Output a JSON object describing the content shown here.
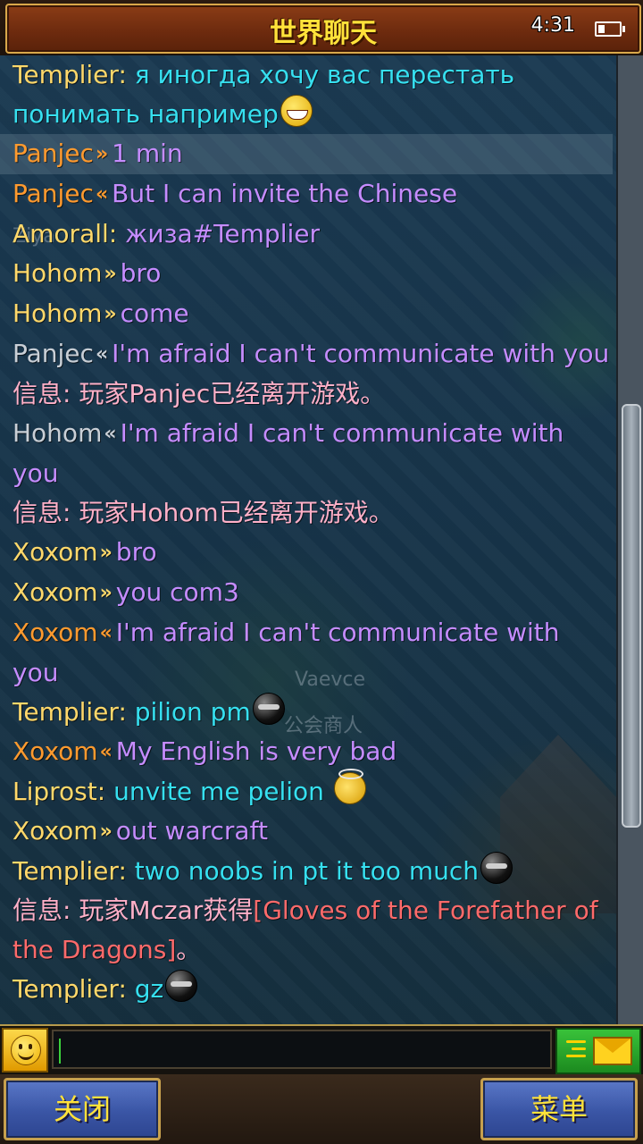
{
  "header": {
    "title": "世界聊天",
    "time": "4:31"
  },
  "colors": {
    "name_orange": "#ff9a2e",
    "name_yellow": "#ffd86a",
    "name_white": "#c9cfd6",
    "name_pink": "#ffb0c8",
    "world_text": "#36e0f0",
    "whisper_text": "#c58cff",
    "system_text": "#ffb0c8",
    "item_link": "#ff6a6a"
  },
  "background_labels": {
    "npc_name": "Vaevce",
    "shop_label": "公会商人",
    "left_name": "Ziya"
  },
  "messages": [
    {
      "sender": "Templier",
      "sep": ": ",
      "arrow": "",
      "text": "я иногда хочу вас перестать понимать например",
      "emoji": "grin",
      "name_color": "#ffd86a",
      "text_color": "#36e0f0",
      "highlight": false
    },
    {
      "sender": "Panjec",
      "sep": "",
      "arrow": "»",
      "text": "1 min",
      "emoji": "",
      "name_color": "#ff9a2e",
      "text_color": "#c58cff",
      "highlight": true
    },
    {
      "sender": "Panjec",
      "sep": "",
      "arrow": "«",
      "text": "But I can invite the Chinese",
      "emoji": "",
      "name_color": "#ff9a2e",
      "text_color": "#c58cff",
      "highlight": false
    },
    {
      "sender": "Amorall",
      "sep": ": ",
      "arrow": "",
      "text": "жиза#Templier",
      "emoji": "",
      "name_color": "#ffd86a",
      "text_color": "#c58cff",
      "highlight": false
    },
    {
      "sender": "Hohom",
      "sep": "",
      "arrow": "»",
      "text": "bro",
      "emoji": "",
      "name_color": "#ffd86a",
      "text_color": "#c58cff",
      "highlight": false
    },
    {
      "sender": "Hohom",
      "sep": "",
      "arrow": "»",
      "text": "come",
      "emoji": "",
      "name_color": "#ffd86a",
      "text_color": "#c58cff",
      "highlight": false
    },
    {
      "sender": "Panjec",
      "sep": "",
      "arrow": "«",
      "text": "I'm afraid I can't communicate with you",
      "emoji": "",
      "name_color": "#c9cfd6",
      "text_color": "#c58cff",
      "highlight": false
    },
    {
      "sender": "信息",
      "sep": ": ",
      "arrow": "",
      "text": "玩家Panjec已经离开游戏。",
      "emoji": "",
      "name_color": "#ffb0c8",
      "text_color": "#ffb0c8",
      "highlight": false
    },
    {
      "sender": "Hohom",
      "sep": "",
      "arrow": "«",
      "text": "I'm afraid I can't communicate with you",
      "emoji": "",
      "name_color": "#c9cfd6",
      "text_color": "#c58cff",
      "highlight": false
    },
    {
      "sender": "信息",
      "sep": ": ",
      "arrow": "",
      "text": "玩家Hohom已经离开游戏。",
      "emoji": "",
      "name_color": "#ffb0c8",
      "text_color": "#ffb0c8",
      "highlight": false
    },
    {
      "sender": "Xoxom",
      "sep": "",
      "arrow": "»",
      "text": "bro",
      "emoji": "",
      "name_color": "#ffd86a",
      "text_color": "#c58cff",
      "highlight": false
    },
    {
      "sender": "Xoxom",
      "sep": "",
      "arrow": "»",
      "text": "you com3",
      "emoji": "",
      "name_color": "#ffd86a",
      "text_color": "#c58cff",
      "highlight": false
    },
    {
      "sender": "Xoxom",
      "sep": "",
      "arrow": "«",
      "text": "I'm afraid I can't communicate with you",
      "emoji": "",
      "name_color": "#ff9a2e",
      "text_color": "#c58cff",
      "highlight": false
    },
    {
      "sender": "Templier",
      "sep": ": ",
      "arrow": "",
      "text": "pilion pm",
      "emoji": "ball",
      "name_color": "#ffd86a",
      "text_color": "#36e0f0",
      "highlight": false
    },
    {
      "sender": "Xoxom",
      "sep": "",
      "arrow": "«",
      "text": "My English is very bad",
      "emoji": "",
      "name_color": "#ff9a2e",
      "text_color": "#c58cff",
      "highlight": false
    },
    {
      "sender": "Liprost",
      "sep": ": ",
      "arrow": "",
      "text": "unvite me pelion ",
      "emoji": "angel",
      "name_color": "#ffd86a",
      "text_color": "#36e0f0",
      "highlight": false
    },
    {
      "sender": "Xoxom",
      "sep": "",
      "arrow": "»",
      "text": "out warcraft",
      "emoji": "",
      "name_color": "#ffd86a",
      "text_color": "#c58cff",
      "highlight": false
    },
    {
      "sender": "Templier",
      "sep": ": ",
      "arrow": "",
      "text": "two noobs in pt it too much",
      "emoji": "ball",
      "name_color": "#ffd86a",
      "text_color": "#36e0f0",
      "highlight": false
    },
    {
      "sender": "信息",
      "sep": ": ",
      "arrow": "",
      "text": "玩家Mczar获得",
      "link": "[Gloves of the Forefather of the Dragons]",
      "after": "。",
      "emoji": "",
      "name_color": "#ffb0c8",
      "text_color": "#ffb0c8",
      "highlight": false
    },
    {
      "sender": "Templier",
      "sep": ": ",
      "arrow": "",
      "text": "gz",
      "emoji": "ball",
      "name_color": "#ffd86a",
      "text_color": "#36e0f0",
      "highlight": false
    }
  ],
  "input": {
    "value": "",
    "placeholder": ""
  },
  "icons": {
    "emote": "smiley-icon",
    "send": "envelope-icon"
  },
  "footer": {
    "close_label": "关闭",
    "menu_label": "菜单"
  }
}
